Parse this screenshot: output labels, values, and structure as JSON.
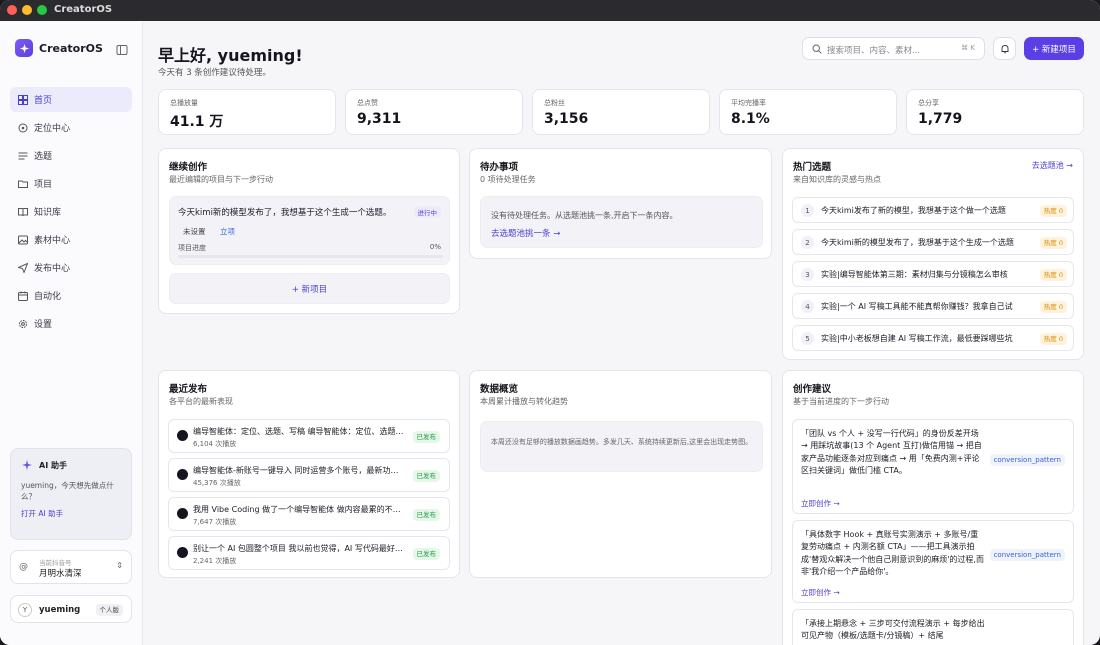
{
  "window": {
    "title": "CreatorOS"
  },
  "brand": {
    "name": "CreatorOS"
  },
  "nav": [
    {
      "label": "首页",
      "icon": "home-icon",
      "active": true
    },
    {
      "label": "定位中心",
      "icon": "target-icon"
    },
    {
      "label": "选题",
      "icon": "list-icon"
    },
    {
      "label": "项目",
      "icon": "folder-icon"
    },
    {
      "label": "知识库",
      "icon": "book-icon"
    },
    {
      "label": "素材中心",
      "icon": "image-icon"
    },
    {
      "label": "发布中心",
      "icon": "send-icon"
    },
    {
      "label": "自动化",
      "icon": "calendar-icon"
    },
    {
      "label": "设置",
      "icon": "gear-icon"
    }
  ],
  "ai_assistant": {
    "title": "AI 助手",
    "text": "yueming，今天想先做点什么？",
    "link": "打开 AI 助手"
  },
  "account": {
    "label": "当前抖音号",
    "name": "月明水清深",
    "icon": "@"
  },
  "user": {
    "avatar": "Y",
    "name": "yueming",
    "badge": "个人版"
  },
  "header": {
    "greeting": "早上好, yueming!",
    "subtitle": "今天有 3 条创作建议待处理。",
    "search_placeholder": "搜索项目、内容、素材...",
    "search_shortcut": "⌘ K",
    "new_button": "+ 新建项目"
  },
  "stats": [
    {
      "label": "总播放量",
      "value": "41.1 万"
    },
    {
      "label": "总点赞",
      "value": "9,311"
    },
    {
      "label": "总粉丝",
      "value": "3,156"
    },
    {
      "label": "平均完播率",
      "value": "8.1%"
    },
    {
      "label": "总分享",
      "value": "1,779"
    }
  ],
  "continue": {
    "title": "继续创作",
    "subtitle": "最近编辑的项目与下一步行动",
    "project": {
      "title": "今天kimi新的模型发布了，我想基于这个生成一个选题。",
      "status": "进行中",
      "unset": "未设置",
      "tag": "立项",
      "progress_label": "项目进度",
      "progress_value": "0%",
      "progress": 0
    },
    "new_project": "+  新项目"
  },
  "todo": {
    "title": "待办事项",
    "subtitle": "0 项待处理任务",
    "empty_text": "没有待处理任务。从选题池挑一条,开启下一条内容。",
    "link": "去选题池挑一条 →"
  },
  "hot": {
    "title": "热门选题",
    "subtitle": "来自知识库的灵感与热点",
    "link": "去选题池 →",
    "items": [
      {
        "num": "1",
        "text": "今天kimi发布了新的模型，我想基于这个做一个选题",
        "badge": "热度 0"
      },
      {
        "num": "2",
        "text": "今天kimi新的模型发布了，我想基于这个生成一个选题",
        "badge": "热度 0"
      },
      {
        "num": "3",
        "text": "实验|编导智能体第三期：素材归集与分镜稿怎么审核",
        "badge": "热度 0"
      },
      {
        "num": "4",
        "text": "实验|一个 AI 写稿工具能不能真帮你赚钱？我拿自己试",
        "badge": "热度 0"
      },
      {
        "num": "5",
        "text": "实验|中小老板想自建 AI 写稿工作流，最低要踩哪些坑",
        "badge": "热度 0"
      }
    ]
  },
  "recent": {
    "title": "最近发布",
    "subtitle": "各平台的最新表现",
    "items": [
      {
        "title": "编导智能体：定位、选题、写稿 编导智能体：定位、选题、写稿",
        "plays": "6,104 次播放",
        "badge": "已发布"
      },
      {
        "title": "编导智能体-新账号一键导入 同时运营多个账号，最新功能上线",
        "plays": "45,376 次播放",
        "badge": "已发布"
      },
      {
        "title": "我用 Vibe Coding 做了一个编导智能体 做内容最累的不是拍摄",
        "plays": "7,647 次播放",
        "badge": "已发布"
      },
      {
        "title": "别让一个 AI 包圆整个项目 我以前也觉得，AI 写代码最好一步到位",
        "plays": "2,241 次播放",
        "badge": "已发布"
      }
    ]
  },
  "overview": {
    "title": "数据概览",
    "subtitle": "本周累计播放与转化趋势",
    "empty_text": "本周还没有足够的播放数据画趋势。多发几天、系统持续更新后,这里会出现走势图。"
  },
  "suggestions": {
    "title": "创作建议",
    "subtitle": "基于当前进度的下一步行动",
    "items": [
      {
        "text": "「团队 vs 个人 + 没写一行代码」的身份反差开场 → 用踩坑故事(13 个 Agent 互打)做信用锚 → 把自家产品功能逐条对应到痛点 → 用「免费内测+评论区扫关键词」做低门槛 CTA。",
        "tag": "conversion_pattern",
        "link": "立即创作 →"
      },
      {
        "text": "「具体数字 Hook + 真账号实测演示 + 多账号/重复劳动痛点 + 内测名额 CTA」——把工具演示拍成'替观众解决一个他自己刚意识到的麻烦'的过程,而非'我介绍一个产品给你'。",
        "tag": "conversion_pattern",
        "link": "立即创作 →"
      },
      {
        "text": "「承接上期悬念 + 三步可交付流程演示 + 每步给出可见产物（模板/选题卡/分镜稿）+ 结尾",
        "tag": "",
        "link": ""
      }
    ]
  }
}
